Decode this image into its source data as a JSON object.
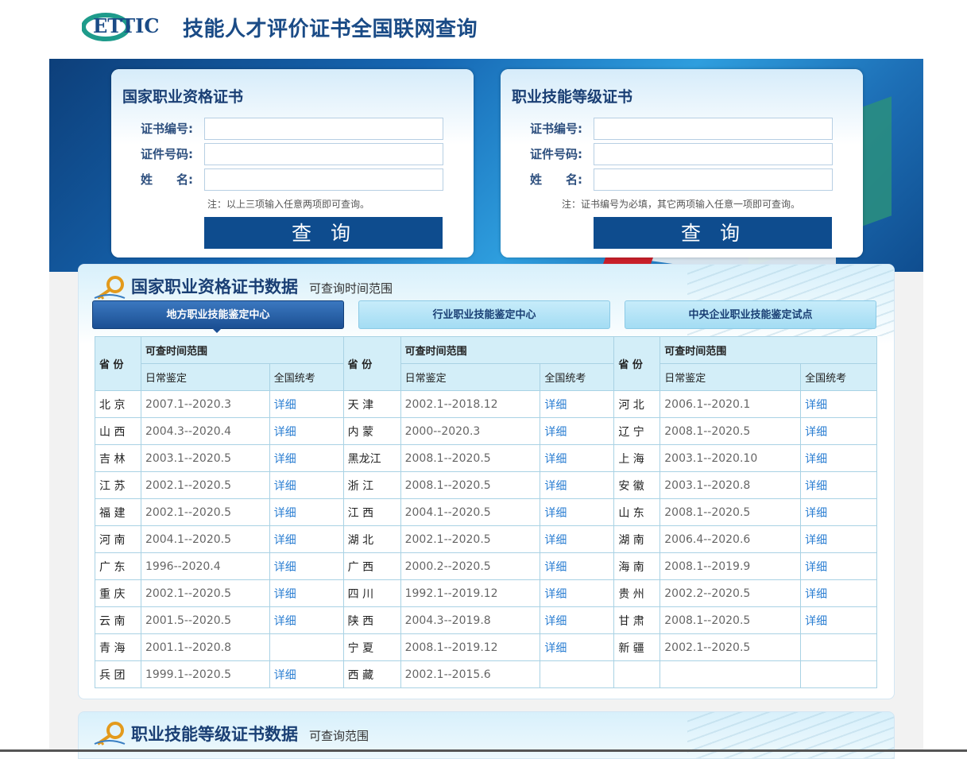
{
  "header": {
    "logo_text": "ETTIC",
    "title": "技能人才评价证书全国联网查询"
  },
  "colors": {
    "brand_blue": "#1a4b86",
    "button_blue": "#0e4c8e",
    "link_blue": "#2a7ed2",
    "logo_teal": "#1e9b8b"
  },
  "query_cards": [
    {
      "title": "国家职业资格证书",
      "fields": [
        {
          "label": "证书编号:",
          "value": "",
          "placeholder": ""
        },
        {
          "label": "证件号码:",
          "value": "",
          "placeholder": ""
        },
        {
          "label": "姓　　名:",
          "value": "",
          "placeholder": ""
        }
      ],
      "note": "注：以上三项输入任意两项即可查询。",
      "button": "查询"
    },
    {
      "title": "职业技能等级证书",
      "fields": [
        {
          "label": "证书编号:",
          "value": "",
          "placeholder": ""
        },
        {
          "label": "证件号码:",
          "value": "",
          "placeholder": ""
        },
        {
          "label": "姓　　名:",
          "value": "",
          "placeholder": ""
        }
      ],
      "note": "注：证书编号为必填，其它两项输入任意一项即可查询。",
      "button": "查询"
    }
  ],
  "panel": {
    "title": "国家职业资格证书数据",
    "subtitle": "可查询时间范围",
    "tabs": [
      {
        "label": "地方职业技能鉴定中心",
        "active": true
      },
      {
        "label": "行业职业技能鉴定中心",
        "active": false
      },
      {
        "label": "中央企业职业技能鉴定试点",
        "active": false
      }
    ],
    "table_headers": {
      "province": "省 份",
      "range": "可查时间范围",
      "daily": "日常鉴定",
      "national": "全国统考"
    },
    "rows": [
      [
        [
          "北 京",
          "2007.1--2020.3",
          "详细"
        ],
        [
          "天 津",
          "2002.1--2018.12",
          "详细"
        ],
        [
          "河 北",
          "2006.1--2020.1",
          "详细"
        ]
      ],
      [
        [
          "山 西",
          "2004.3--2020.4",
          "详细"
        ],
        [
          "内 蒙",
          "2000--2020.3",
          "详细"
        ],
        [
          "辽 宁",
          "2008.1--2020.5",
          "详细"
        ]
      ],
      [
        [
          "吉 林",
          "2003.1--2020.5",
          "详细"
        ],
        [
          "黑龙江",
          "2008.1--2020.5",
          "详细"
        ],
        [
          "上 海",
          "2003.1--2020.10",
          "详细"
        ]
      ],
      [
        [
          "江 苏",
          "2002.1--2020.5",
          "详细"
        ],
        [
          "浙 江",
          "2008.1--2020.5",
          "详细"
        ],
        [
          "安 徽",
          "2003.1--2020.8",
          "详细"
        ]
      ],
      [
        [
          "福 建",
          "2002.1--2020.5",
          "详细"
        ],
        [
          "江 西",
          "2004.1--2020.5",
          "详细"
        ],
        [
          "山 东",
          "2008.1--2020.5",
          "详细"
        ]
      ],
      [
        [
          "河 南",
          "2004.1--2020.5",
          "详细"
        ],
        [
          "湖 北",
          "2002.1--2020.5",
          "详细"
        ],
        [
          "湖 南",
          "2006.4--2020.6",
          "详细"
        ]
      ],
      [
        [
          "广 东",
          "1996--2020.4",
          "详细"
        ],
        [
          "广 西",
          "2000.2--2020.5",
          "详细"
        ],
        [
          "海 南",
          "2008.1--2019.9",
          "详细"
        ]
      ],
      [
        [
          "重 庆",
          "2002.1--2020.5",
          "详细"
        ],
        [
          "四 川",
          "1992.1--2019.12",
          "详细"
        ],
        [
          "贵 州",
          "2002.2--2020.5",
          "详细"
        ]
      ],
      [
        [
          "云 南",
          "2001.5--2020.5",
          "详细"
        ],
        [
          "陕 西",
          "2004.3--2019.8",
          "详细"
        ],
        [
          "甘 肃",
          "2008.1--2020.5",
          "详细"
        ]
      ],
      [
        [
          "青 海",
          "2001.1--2020.8",
          ""
        ],
        [
          "宁 夏",
          "2008.1--2019.12",
          "详细"
        ],
        [
          "新 疆",
          "2002.1--2020.5",
          ""
        ]
      ],
      [
        [
          "兵 团",
          "1999.1--2020.5",
          "详细"
        ],
        [
          "西 藏",
          "2002.1--2015.6",
          ""
        ],
        [
          "",
          "",
          ""
        ]
      ]
    ]
  },
  "panel2": {
    "title": "职业技能等级证书数据",
    "subtitle": "可查询范围"
  }
}
